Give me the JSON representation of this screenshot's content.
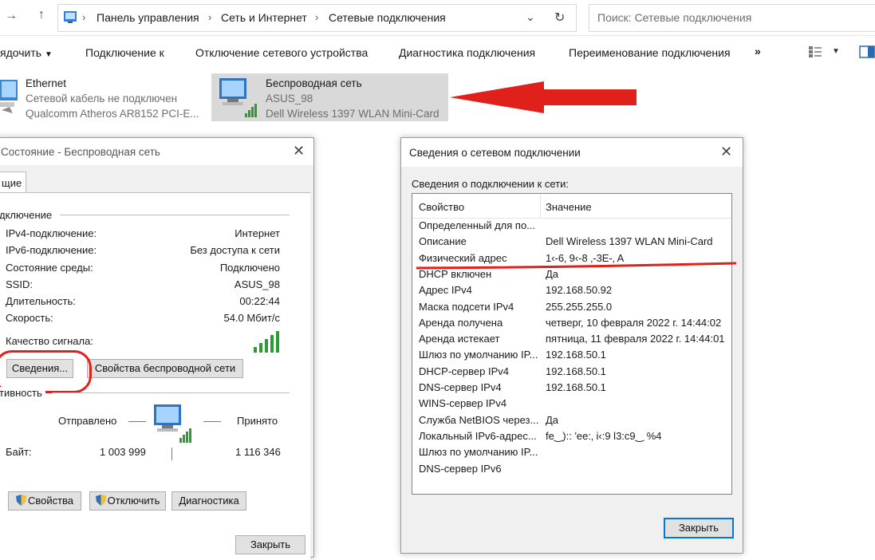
{
  "explorer": {
    "breadcrumb": [
      "Панель управления",
      "Сеть и Интернет",
      "Сетевые подключения"
    ],
    "search_placeholder": "Поиск: Сетевые подключения",
    "toolbar": {
      "organize": "ядочить",
      "connect_to": "Подключение к",
      "disable": "Отключение сетевого устройства",
      "diagnose": "Диагностика подключения",
      "rename": "Переименование подключения",
      "more": "»"
    },
    "adapters": [
      {
        "name": "Ethernet",
        "status": "Сетевой кабель не подключен",
        "device": "Qualcomm Atheros AR8152 PCI-E..."
      },
      {
        "name": "Беспроводная сеть",
        "status": "ASUS_98",
        "device": "Dell Wireless 1397 WLAN Mini-Card"
      }
    ]
  },
  "status_dialog": {
    "title": "Состояние - Беспроводная сеть",
    "tab": "щие",
    "connection_group": "дключение",
    "fields": [
      {
        "label": "IPv4-подключение:",
        "value": "Интернет"
      },
      {
        "label": "IPv6-подключение:",
        "value": "Без доступа к сети"
      },
      {
        "label": "Состояние среды:",
        "value": "Подключено"
      },
      {
        "label": "SSID:",
        "value": "ASUS_98"
      },
      {
        "label": "Длительность:",
        "value": "00:22:44"
      },
      {
        "label": "Скорость:",
        "value": "54.0 Мбит/с"
      }
    ],
    "signal_label": "Качество сигнала:",
    "details_button": "Сведения...",
    "wireless_props_button": "Свойства беспроводной сети",
    "activity_group": "тивность",
    "sent_label": "Отправлено",
    "received_label": "Принято",
    "bytes_label": "Байт:",
    "bytes_sent": "1 003 999",
    "bytes_received": "1 116 346",
    "properties_button": "Свойства",
    "disable_button": "Отключить",
    "diagnose_button": "Диагностика",
    "close_button": "Закрыть"
  },
  "details_dialog": {
    "title": "Сведения о сетевом подключении",
    "subtitle": "Сведения о подключении к сети:",
    "col_property": "Свойство",
    "col_value": "Значение",
    "rows": [
      {
        "p": "Определенный для по...",
        "v": ""
      },
      {
        "p": "Описание",
        "v": "Dell Wireless 1397 WLAN Mini-Card"
      },
      {
        "p": "Физический адрес",
        "v": "1‹-6‚ 9‹-8 ‚-3E-‚ A"
      },
      {
        "p": "DHCP включен",
        "v": "Да"
      },
      {
        "p": "Адрес IPv4",
        "v": "192.168.50.92"
      },
      {
        "p": "Маска подсети IPv4",
        "v": "255.255.255.0"
      },
      {
        "p": "Аренда получена",
        "v": "четверг, 10 февраля 2022 г. 14:44:02"
      },
      {
        "p": "Аренда истекает",
        "v": "пятница, 11 февраля 2022 г. 14:44:01"
      },
      {
        "p": "Шлюз по умолчанию IP...",
        "v": "192.168.50.1"
      },
      {
        "p": "DHCP-сервер IPv4",
        "v": "192.168.50.1"
      },
      {
        "p": "DNS-сервер IPv4",
        "v": "192.168.50.1"
      },
      {
        "p": "WINS-сервер IPv4",
        "v": ""
      },
      {
        "p": "Служба NetBIOS через...",
        "v": "Да"
      },
      {
        "p": "Локальный IPv6-адрес...",
        "v": "fe‿):: 'ee:‚ i‹:9  l3:c9‿ %4"
      },
      {
        "p": "Шлюз по умолчанию IP...",
        "v": ""
      },
      {
        "p": "DNS-сервер IPv6",
        "v": ""
      }
    ],
    "close_button": "Закрыть"
  },
  "colors": {
    "annotation": "#e0201b",
    "selection": "#d9d9d9",
    "dialog_bg": "#f0f0f0"
  }
}
